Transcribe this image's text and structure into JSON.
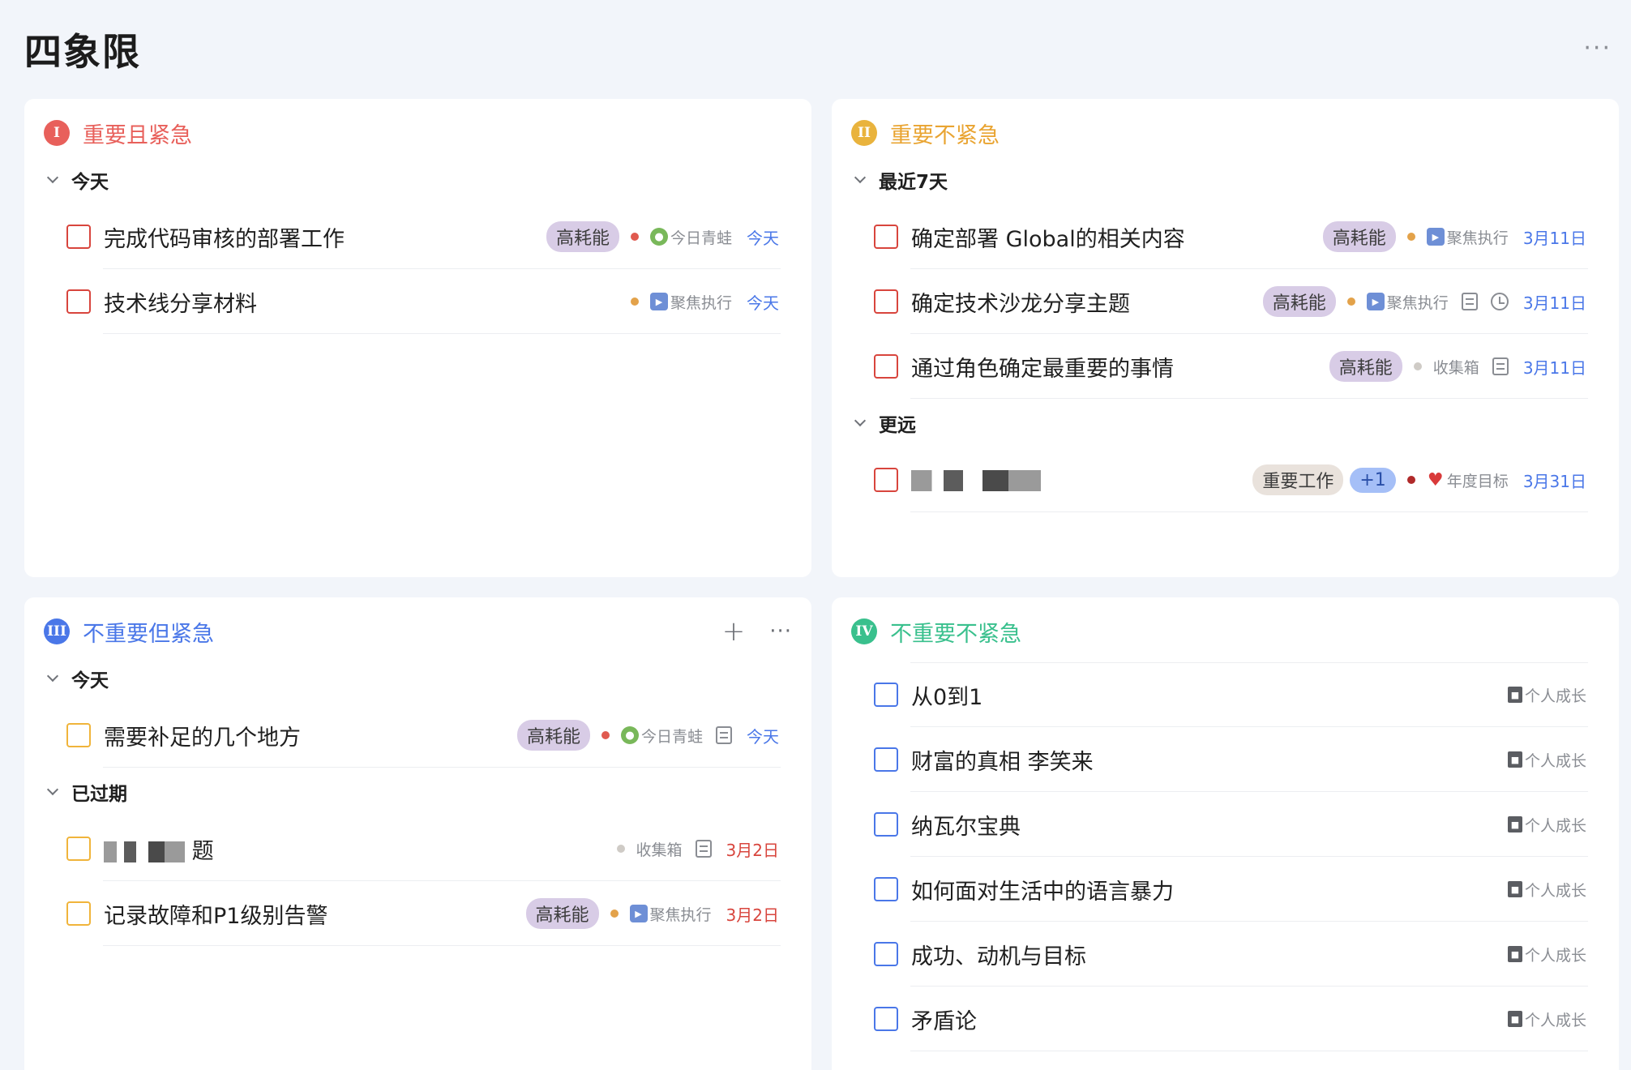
{
  "page": {
    "title": "四象限"
  },
  "colors": {
    "red": "#e8605b",
    "orange": "#e9a431",
    "blue": "#4a77e8",
    "green": "#39c08d",
    "tag_purple": "#d8cce6"
  },
  "q1": {
    "badge": "I",
    "title": "重要且紧急",
    "groups": [
      {
        "label": "今天",
        "tasks": [
          {
            "title": "完成代码审核的部署工作",
            "tag": "高耗能",
            "project_icon": "frog-icon",
            "project": "今日青蛙",
            "date": "今天"
          },
          {
            "title": "技术线分享材料",
            "project_icon": "play-icon",
            "project": "聚焦执行",
            "date": "今天"
          }
        ]
      }
    ]
  },
  "q2": {
    "badge": "II",
    "title": "重要不紧急",
    "groups": [
      {
        "label": "最近7天",
        "tasks": [
          {
            "title": "确定部署 Global的相关内容",
            "tag": "高耗能",
            "project_icon": "play-icon",
            "project": "聚焦执行",
            "date": "3月11日"
          },
          {
            "title": "确定技术沙龙分享主题",
            "tag": "高耗能",
            "project_icon": "play-icon",
            "project": "聚焦执行",
            "date": "3月11日"
          },
          {
            "title": "通过角色确定最重要的事情",
            "tag": "高耗能",
            "project": "收集箱",
            "date": "3月11日"
          }
        ]
      },
      {
        "label": "更远",
        "tasks": [
          {
            "title_prefix": "",
            "title_suffix": "",
            "tag": "重要工作",
            "extra": "+1",
            "project_icon": "heart-icon",
            "project": "年度目标",
            "date": "3月31日"
          }
        ]
      }
    ]
  },
  "q3": {
    "badge": "III",
    "title": "不重要但紧急",
    "groups": [
      {
        "label": "今天",
        "tasks": [
          {
            "title": "需要补足的几个地方",
            "tag": "高耗能",
            "project_icon": "frog-icon",
            "project": "今日青蛙",
            "date": "今天"
          }
        ]
      },
      {
        "label": "已过期",
        "tasks": [
          {
            "title_suffix": "题",
            "project": "收集箱",
            "date": "3月2日"
          },
          {
            "title": "记录故障和P1级别告警",
            "tag": "高耗能",
            "project_icon": "play-icon",
            "project": "聚焦执行",
            "date": "3月2日"
          }
        ]
      }
    ]
  },
  "q4": {
    "badge": "IV",
    "title": "不重要不紧急",
    "tasks": [
      {
        "title": "从0到1",
        "project": "个人成长"
      },
      {
        "title": "财富的真相 李笑来",
        "project": "个人成长"
      },
      {
        "title": "纳瓦尔宝典",
        "project": "个人成长"
      },
      {
        "title": "如何面对生活中的语言暴力",
        "project": "个人成长"
      },
      {
        "title": "成功、动机与目标",
        "project": "个人成长"
      },
      {
        "title": "矛盾论",
        "project": "个人成长"
      }
    ]
  }
}
